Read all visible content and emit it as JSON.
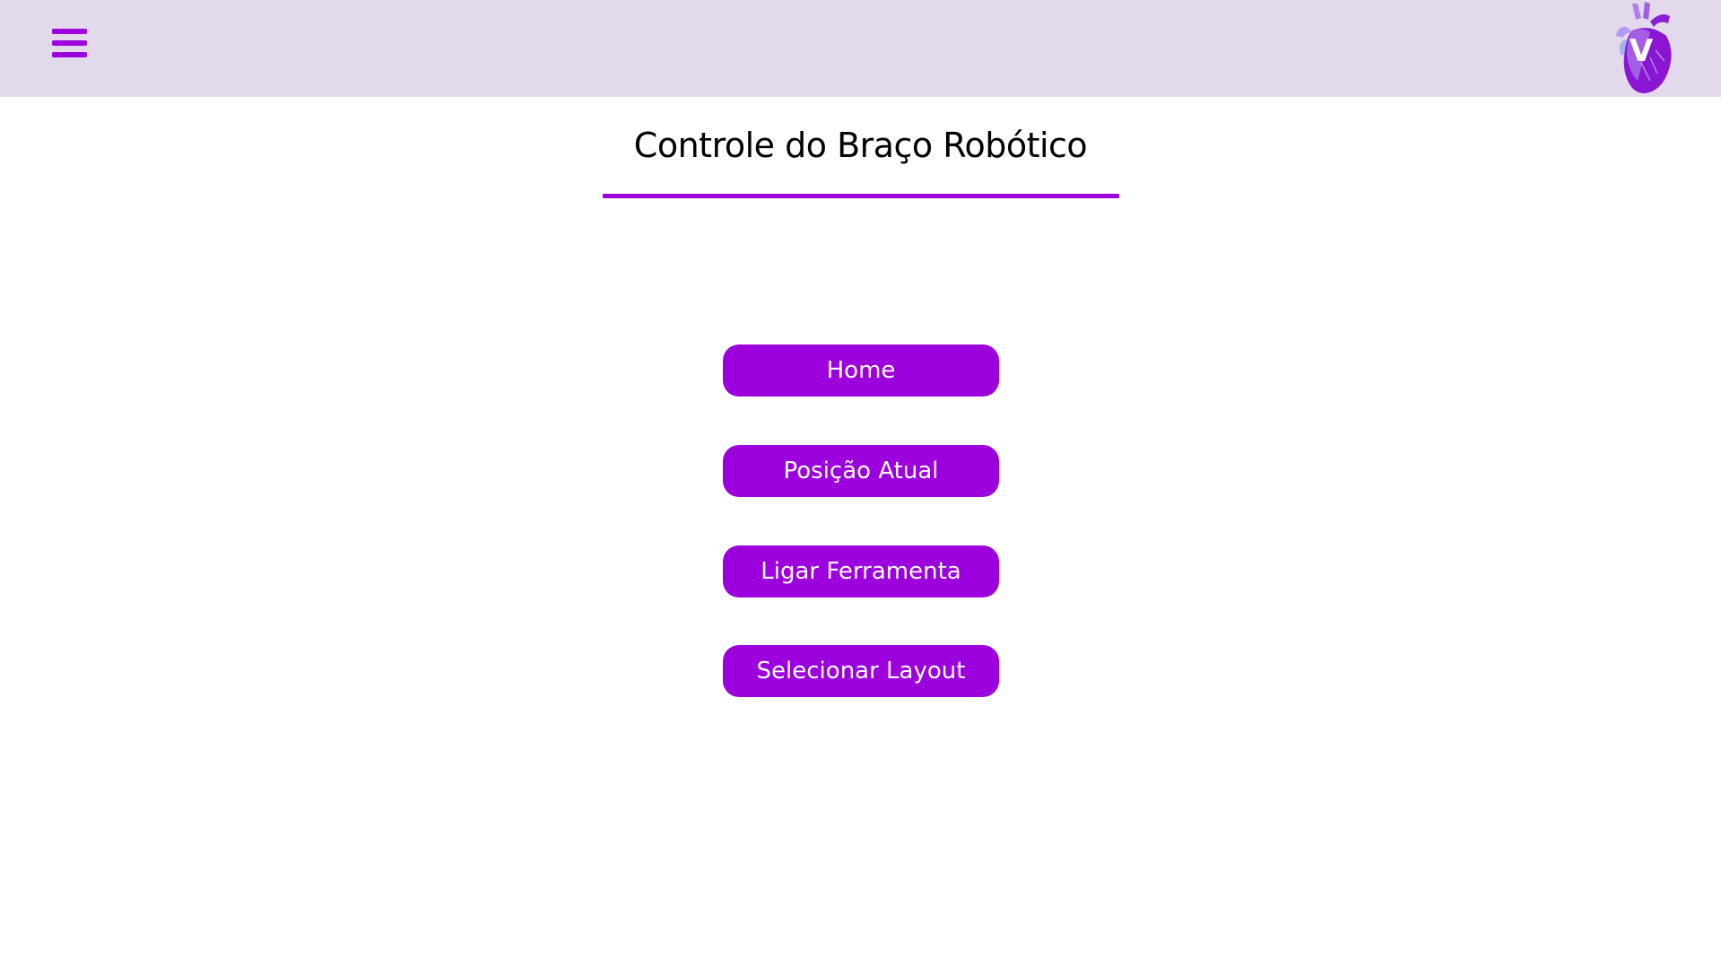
{
  "header": {
    "menu_icon": "hamburger-menu-icon",
    "logo_letter": "V",
    "logo_icon": "heart-logo-icon",
    "background": "#e3d9ec"
  },
  "main": {
    "title": "Controle do Braço Robótico",
    "buttons": [
      {
        "label": "Home"
      },
      {
        "label": "Posição Atual"
      },
      {
        "label": "Ligar Ferramenta"
      },
      {
        "label": "Selecionar Layout"
      }
    ]
  },
  "colors": {
    "accent": "#9b00dd",
    "button_text": "#ffffff"
  }
}
